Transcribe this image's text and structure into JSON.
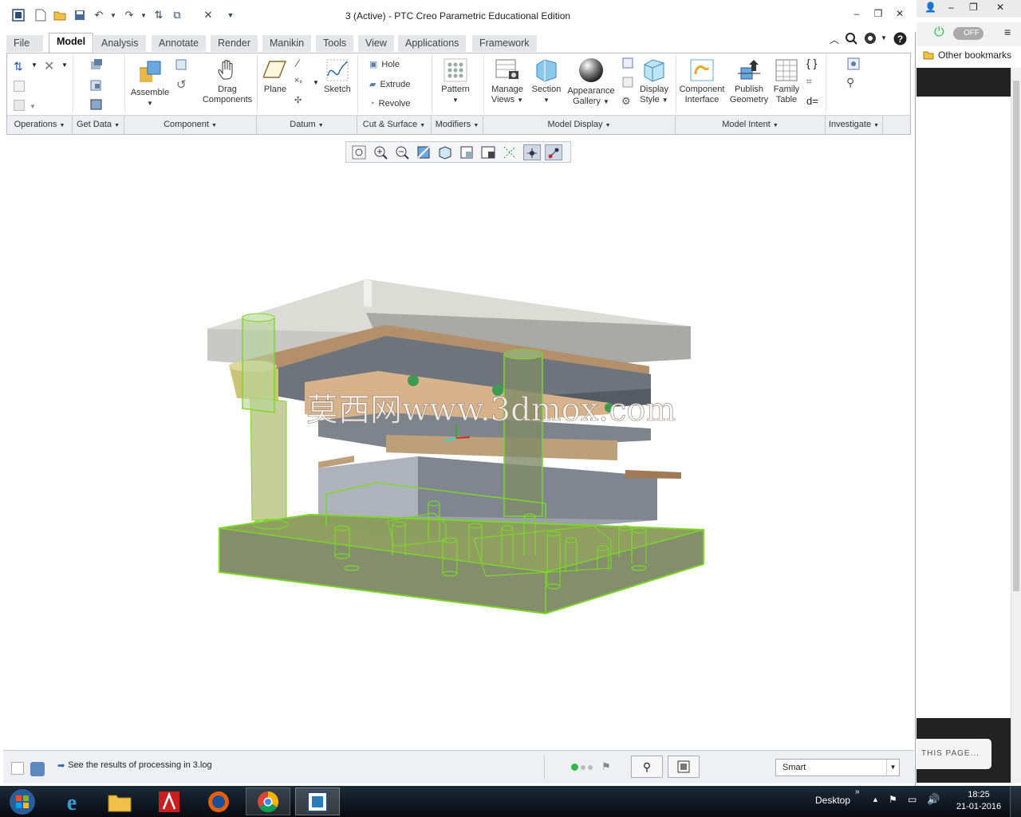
{
  "window": {
    "title": "3 (Active) - PTC Creo Parametric Educational Edition"
  },
  "tabs": [
    {
      "label": "File"
    },
    {
      "label": "Model"
    },
    {
      "label": "Analysis"
    },
    {
      "label": "Annotate"
    },
    {
      "label": "Render"
    },
    {
      "label": "Manikin"
    },
    {
      "label": "Tools"
    },
    {
      "label": "View"
    },
    {
      "label": "Applications"
    },
    {
      "label": "Framework"
    }
  ],
  "ribbon": {
    "assemble": "Assemble",
    "drag1": "Drag",
    "drag2": "Components",
    "plane": "Plane",
    "sketch": "Sketch",
    "hole": "Hole",
    "extrude": "Extrude",
    "revolve": "Revolve",
    "pattern": "Pattern",
    "manage1": "Manage",
    "manage2": "Views",
    "section": "Section",
    "appearance1": "Appearance",
    "appearance2": "Gallery",
    "display1": "Display",
    "display2": "Style",
    "compint1": "Component",
    "compint2": "Interface",
    "publish1": "Publish",
    "publish2": "Geometry",
    "family1": "Family",
    "family2": "Table"
  },
  "groups": [
    {
      "label": "Operations"
    },
    {
      "label": "Get Data"
    },
    {
      "label": "Component"
    },
    {
      "label": "Datum"
    },
    {
      "label": "Cut & Surface"
    },
    {
      "label": "Modifiers"
    },
    {
      "label": "Model Display"
    },
    {
      "label": "Model Intent"
    },
    {
      "label": "Investigate"
    }
  ],
  "graphics": {
    "watermark": "莫西网www.3dmox.com"
  },
  "status": {
    "message": "See the results of processing in 3.log",
    "filter": "Smart"
  },
  "browser": {
    "toggle": "OFF",
    "bookmarks": "Other bookmarks",
    "this_page": "THIS PAGE..."
  },
  "taskbar": {
    "desktop": "Desktop",
    "time": "18:25",
    "date": "21-01-2016"
  },
  "colors": {
    "accent": "#7cd62a",
    "status_green": "#2eb84a"
  }
}
